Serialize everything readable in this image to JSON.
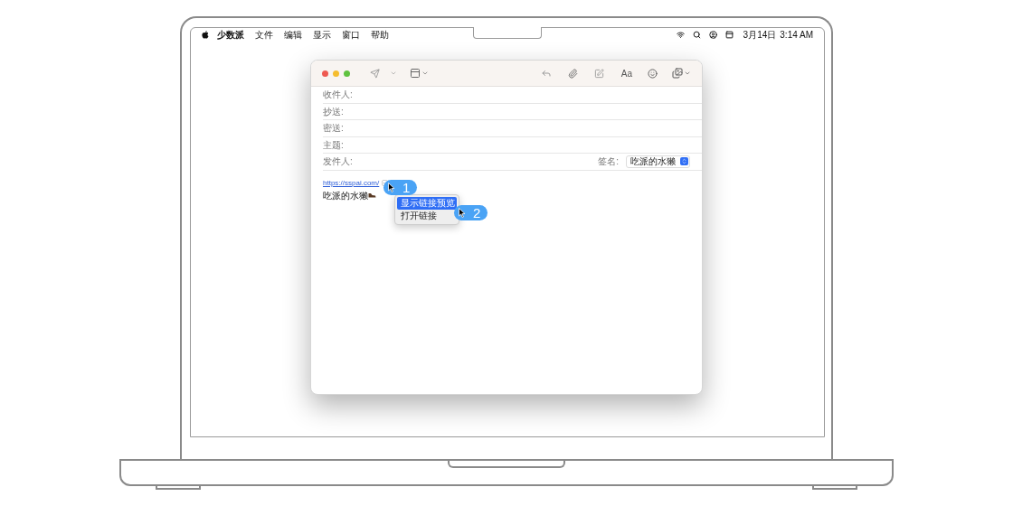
{
  "menubar": {
    "app_name": "少数派",
    "menus": [
      "文件",
      "编辑",
      "显示",
      "窗口",
      "帮助"
    ],
    "date": "3月14日",
    "time": "3:14 AM"
  },
  "toolbar": {
    "format_button": "Aa"
  },
  "header_fields": [
    {
      "label": "收件人:"
    },
    {
      "label": "抄送:"
    },
    {
      "label": "密送:"
    },
    {
      "label": "主题:"
    }
  ],
  "from_field": {
    "label": "发件人:",
    "signature_label": "签名:",
    "signature_value": "吃派的水獭"
  },
  "body": {
    "link": "https://sspai.com/",
    "signature": "吃派的水獭"
  },
  "context_menu": [
    {
      "label": "显示链接预览",
      "selected": true
    },
    {
      "label": "打开链接",
      "selected": false
    }
  ],
  "callouts": [
    "1",
    "2"
  ]
}
